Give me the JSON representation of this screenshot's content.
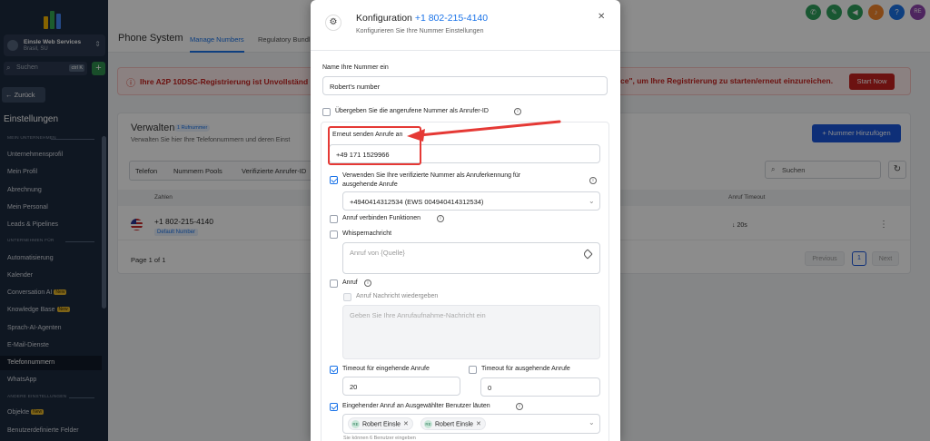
{
  "sidebar": {
    "account_name": "Einsle Web Services",
    "account_location": "Brasil, SU",
    "search_placeholder": "Suchen",
    "search_shortcut": "ctrl K",
    "back_label": "Zurück",
    "settings_title": "Einstellungen",
    "section_company": "MEIN UNTERNEHMEN",
    "section_business": "UNTERNEHMEN",
    "section_business_extra": "FÜR",
    "section_other": "ANDERE EINSTELLUNGEN",
    "new_badge": "New",
    "items": [
      {
        "label": "Unternehmensprofil"
      },
      {
        "label": "Mein Profil"
      },
      {
        "label": "Abrechnung"
      },
      {
        "label": "Mein Personal"
      },
      {
        "label": "Leads & Pipelines"
      },
      {
        "label": "Automatisierung"
      },
      {
        "label": "Kalender"
      },
      {
        "label": "Conversation AI"
      },
      {
        "label": "Knowledge Base"
      },
      {
        "label": "Sprach-AI-Agenten"
      },
      {
        "label": "E-Mail-Dienste"
      },
      {
        "label": "Telefonnummern"
      },
      {
        "label": "WhatsApp"
      },
      {
        "label": "Objekte"
      },
      {
        "label": "Benutzerdefinierte Felder"
      }
    ]
  },
  "topbar": {
    "avatar_initials": "RE",
    "colors": {
      "green": "#2e9e5b",
      "blue": "#1a73e8",
      "orange": "#f4862a",
      "purple": "#8e44ad"
    }
  },
  "page": {
    "title": "Phone System",
    "tabs": [
      "Manage Numbers",
      "Regulatory Bundl"
    ],
    "alert_left": "Ihre A2P 10DSC-Registrierung ist Unvollständ",
    "alert_right": "ce\", um Ihre Registrierung zu starten/erneut einzureichen.",
    "start_now": "Start Now"
  },
  "card": {
    "title": "Verwalten",
    "badge": "1 Rufnummer",
    "subtitle": "Verwalten Sie hier Ihre Telefonnummern und deren Einst",
    "add_button": "Nummer Hinzufügen",
    "tabs": [
      "Telefon",
      "Nummern Pools",
      "Verifizierte Anrufer-ID"
    ],
    "search_placeholder": "Suchen",
    "col_numbers": "Zahlen",
    "col_timeout": "Anruf Timeout",
    "row": {
      "number": "+1 802-215-4140",
      "badge": "Default Number",
      "timeout": "↓ 20s"
    },
    "page_of": "Page 1 of 1",
    "prev": "Previous",
    "page_current": "1",
    "next": "Next"
  },
  "modal": {
    "title": "Konfiguration",
    "phone": "+1 802-215-4140",
    "subtitle": "Konfigurieren Sie Ihre Nummer Einstellungen",
    "name_label": "Name Ihre Nummer ein",
    "name_value": "Robert's number",
    "pass_caller_label": "Übergeben Sie die angerufene Nummer als Anrufer-ID",
    "forward_label": "Erneut senden Anrufe an",
    "forward_value": "+49 171 1529966",
    "verified_label_1": "Verwenden Sie Ihre verifizierte Nummer als Anruferkennung für",
    "verified_label_2": "ausgehende Anrufe",
    "verified_value": "+4940414312534 (EWS 004940414312534)",
    "connect_label": "Anruf verbinden Funktionen",
    "whisper_label": "Whispernachricht",
    "whisper_placeholder": "Anruf von {Quelle}",
    "call_label": "Anruf",
    "play_msg_label": "Anruf Nachricht wiedergeben",
    "record_placeholder": "Geben Sie Ihre Anrufaufnahme-Nachricht ein",
    "timeout_in_label": "Timeout für eingehende Anrufe",
    "timeout_in_value": "20",
    "timeout_out_label": "Timeout für ausgehende Anrufe",
    "timeout_out_value": "0",
    "ring_users_label": "Eingehender Anruf an Ausgewählter Benutzer läuten",
    "chip_initials": "RE",
    "users": [
      "Robert Einsle",
      "Robert Einsle"
    ],
    "users_hint": "Sie können 6 Benutzer eingeben"
  }
}
